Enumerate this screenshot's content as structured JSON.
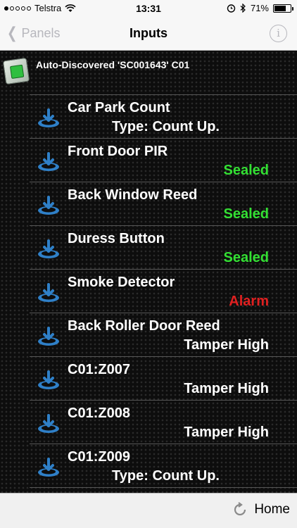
{
  "status_bar": {
    "carrier": "Telstra",
    "time": "13:31",
    "battery": "71%",
    "battery_level": 0.71
  },
  "nav": {
    "back_label": "Panels",
    "title": "Inputs"
  },
  "panel": {
    "label": "Auto-Discovered 'SC001643'   C01"
  },
  "inputs": [
    {
      "name": "Car Park Count",
      "status": "Type: Count Up.",
      "kind": "type"
    },
    {
      "name": "Front Door PIR",
      "status": "Sealed",
      "kind": "sealed"
    },
    {
      "name": "Back Window Reed",
      "status": "Sealed",
      "kind": "sealed"
    },
    {
      "name": "Duress Button",
      "status": "Sealed",
      "kind": "sealed"
    },
    {
      "name": "Smoke Detector",
      "status": "Alarm",
      "kind": "alarm"
    },
    {
      "name": "Back Roller Door Reed",
      "status": "Tamper High",
      "kind": "tamper"
    },
    {
      "name": "C01:Z007",
      "status": "Tamper High",
      "kind": "tamper"
    },
    {
      "name": "C01:Z008",
      "status": "Tamper High",
      "kind": "tamper"
    },
    {
      "name": "C01:Z009",
      "status": "Type: Count Up.",
      "kind": "type"
    }
  ],
  "toolbar": {
    "home_label": "Home"
  },
  "colors": {
    "sealed": "#33e033",
    "alarm": "#e02020",
    "icon_blue": "#2f80c8"
  }
}
